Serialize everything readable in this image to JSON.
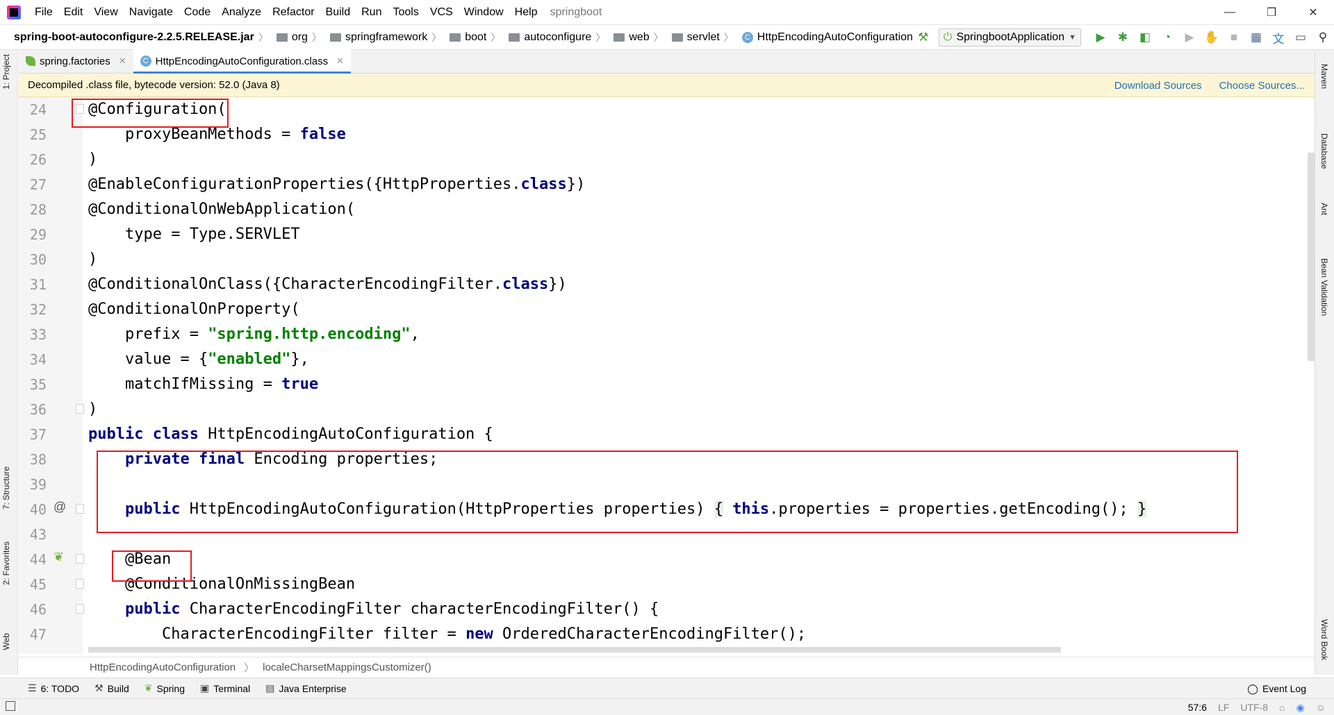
{
  "menu": {
    "items": [
      "File",
      "Edit",
      "View",
      "Navigate",
      "Code",
      "Analyze",
      "Refactor",
      "Build",
      "Run",
      "Tools",
      "VCS",
      "Window",
      "Help"
    ],
    "project": "springboot"
  },
  "window_controls": {
    "minimize": "—",
    "restore": "❐",
    "close": "✕"
  },
  "navbar": {
    "jar": "spring-boot-autoconfigure-2.2.5.RELEASE.jar",
    "packages": [
      "org",
      "springframework",
      "boot",
      "autoconfigure",
      "web",
      "servlet"
    ],
    "class_name": "HttpEncodingAutoConfiguration",
    "run_config": "SpringbootApplication"
  },
  "tabs": [
    {
      "label": "spring.factories",
      "active": false
    },
    {
      "label": "HttpEncodingAutoConfiguration.class",
      "active": true
    }
  ],
  "banner": {
    "text": "Decompiled .class file, bytecode version: 52.0 (Java 8)",
    "download_sources": "Download Sources",
    "choose_sources": "Choose Sources..."
  },
  "lines": [
    "24",
    "25",
    "26",
    "27",
    "28",
    "29",
    "30",
    "31",
    "32",
    "33",
    "34",
    "35",
    "36",
    "37",
    "38",
    "39",
    "40",
    "43",
    "44",
    "45",
    "46",
    "47"
  ],
  "code": {
    "l24": "@Configuration(",
    "l25_a": "    proxyBeanMethods = ",
    "l25_b": "false",
    "l26": ")",
    "l27_a": "@EnableConfigurationProperties({HttpProperties.",
    "l27_b": "class",
    "l27_c": "})",
    "l28": "@ConditionalOnWebApplication(",
    "l29": "    type = Type.SERVLET",
    "l30": ")",
    "l31_a": "@ConditionalOnClass({CharacterEncodingFilter.",
    "l31_b": "class",
    "l31_c": "})",
    "l32": "@ConditionalOnProperty(",
    "l33_a": "    prefix = ",
    "l33_b": "\"spring.http.encoding\"",
    "l33_c": ",",
    "l34_a": "    value = {",
    "l34_b": "\"enabled\"",
    "l34_c": "},",
    "l35_a": "    matchIfMissing = ",
    "l35_b": "true",
    "l36": ")",
    "l37_a": "public class",
    "l37_b": " HttpEncodingAutoConfiguration {",
    "l38_a": "    ",
    "l38_b": "private final",
    "l38_c": " Encoding properties;",
    "l40_a": "    ",
    "l40_b": "public",
    "l40_c": " HttpEncodingAutoConfiguration(HttpProperties properties) ",
    "l40_d": "{",
    "l40_e": " ",
    "l40_f": "this",
    "l40_g": ".properties = properties.getEncoding(); ",
    "l40_h": "}",
    "l44": "    @Bean",
    "l45": "    @ConditionalOnMissingBean",
    "l46_a": "    ",
    "l46_b": "public",
    "l46_c": " CharacterEncodingFilter characterEncodingFilter() {",
    "l47_a": "        CharacterEncodingFilter filter = ",
    "l47_b": "new",
    "l47_c": " OrderedCharacterEncodingFilter();"
  },
  "editor_breadcrumb": [
    "HttpEncodingAutoConfiguration",
    "localeCharsetMappingsCustomizer()"
  ],
  "left_tabs": [
    "1: Project",
    "7: Structure",
    "2: Favorites",
    "Web"
  ],
  "right_tabs": [
    "Maven",
    "Database",
    "Ant",
    "Bean Validation",
    "Word Book"
  ],
  "bottom_tools": [
    "6: TODO",
    "Build",
    "Spring",
    "Terminal",
    "Java Enterprise"
  ],
  "event_log": "Event Log",
  "status": {
    "position": "57:6",
    "line_sep": "LF",
    "encoding": "UTF-8"
  }
}
